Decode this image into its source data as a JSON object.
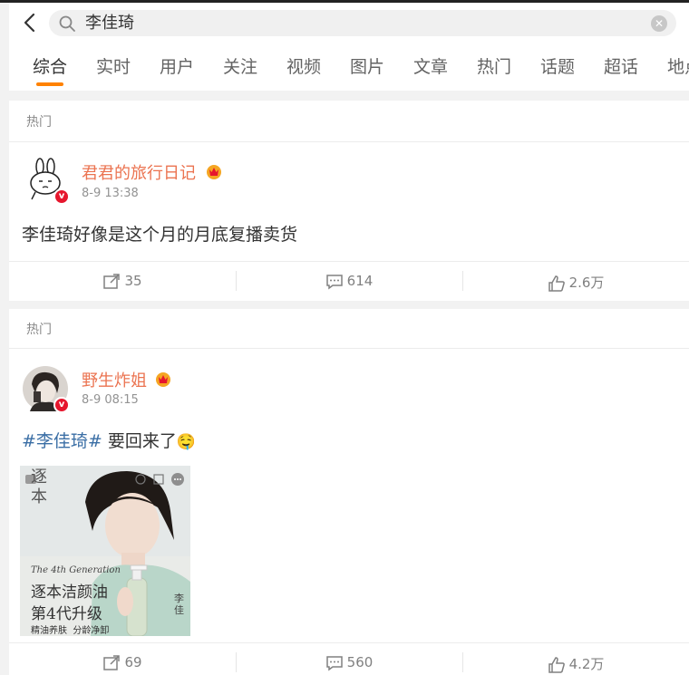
{
  "search": {
    "query": "李佳琦"
  },
  "tabs": [
    {
      "label": "综合",
      "active": true
    },
    {
      "label": "实时"
    },
    {
      "label": "用户"
    },
    {
      "label": "关注"
    },
    {
      "label": "视频"
    },
    {
      "label": "图片"
    },
    {
      "label": "文章"
    },
    {
      "label": "热门"
    },
    {
      "label": "话题"
    },
    {
      "label": "超话"
    },
    {
      "label": "地点"
    }
  ],
  "colors": {
    "accent": "#ff8200",
    "username": "#eb7350",
    "hashtag": "#3a6ea5"
  },
  "posts": [
    {
      "section_label": "热门",
      "username": "君君的旅行日记",
      "time": "8-9 13:38",
      "text": "李佳琦好像是这个月的月底复播卖货",
      "reposts": "35",
      "comments": "614",
      "likes": "2.6万"
    },
    {
      "section_label": "热门",
      "username": "野生炸姐",
      "time": "8-9 08:15",
      "hashtag": "#李佳琦#",
      "text": "要回来了",
      "emoji": "🤤",
      "image": {
        "brand": "逐本",
        "subtitle": "The 4th Generation",
        "line1": "逐本洁颜油",
        "line2": "第4代升级",
        "line3": "精油养肤  分龄净卸",
        "side": "李佳"
      },
      "reposts": "69",
      "comments": "560",
      "likes": "4.2万"
    }
  ]
}
